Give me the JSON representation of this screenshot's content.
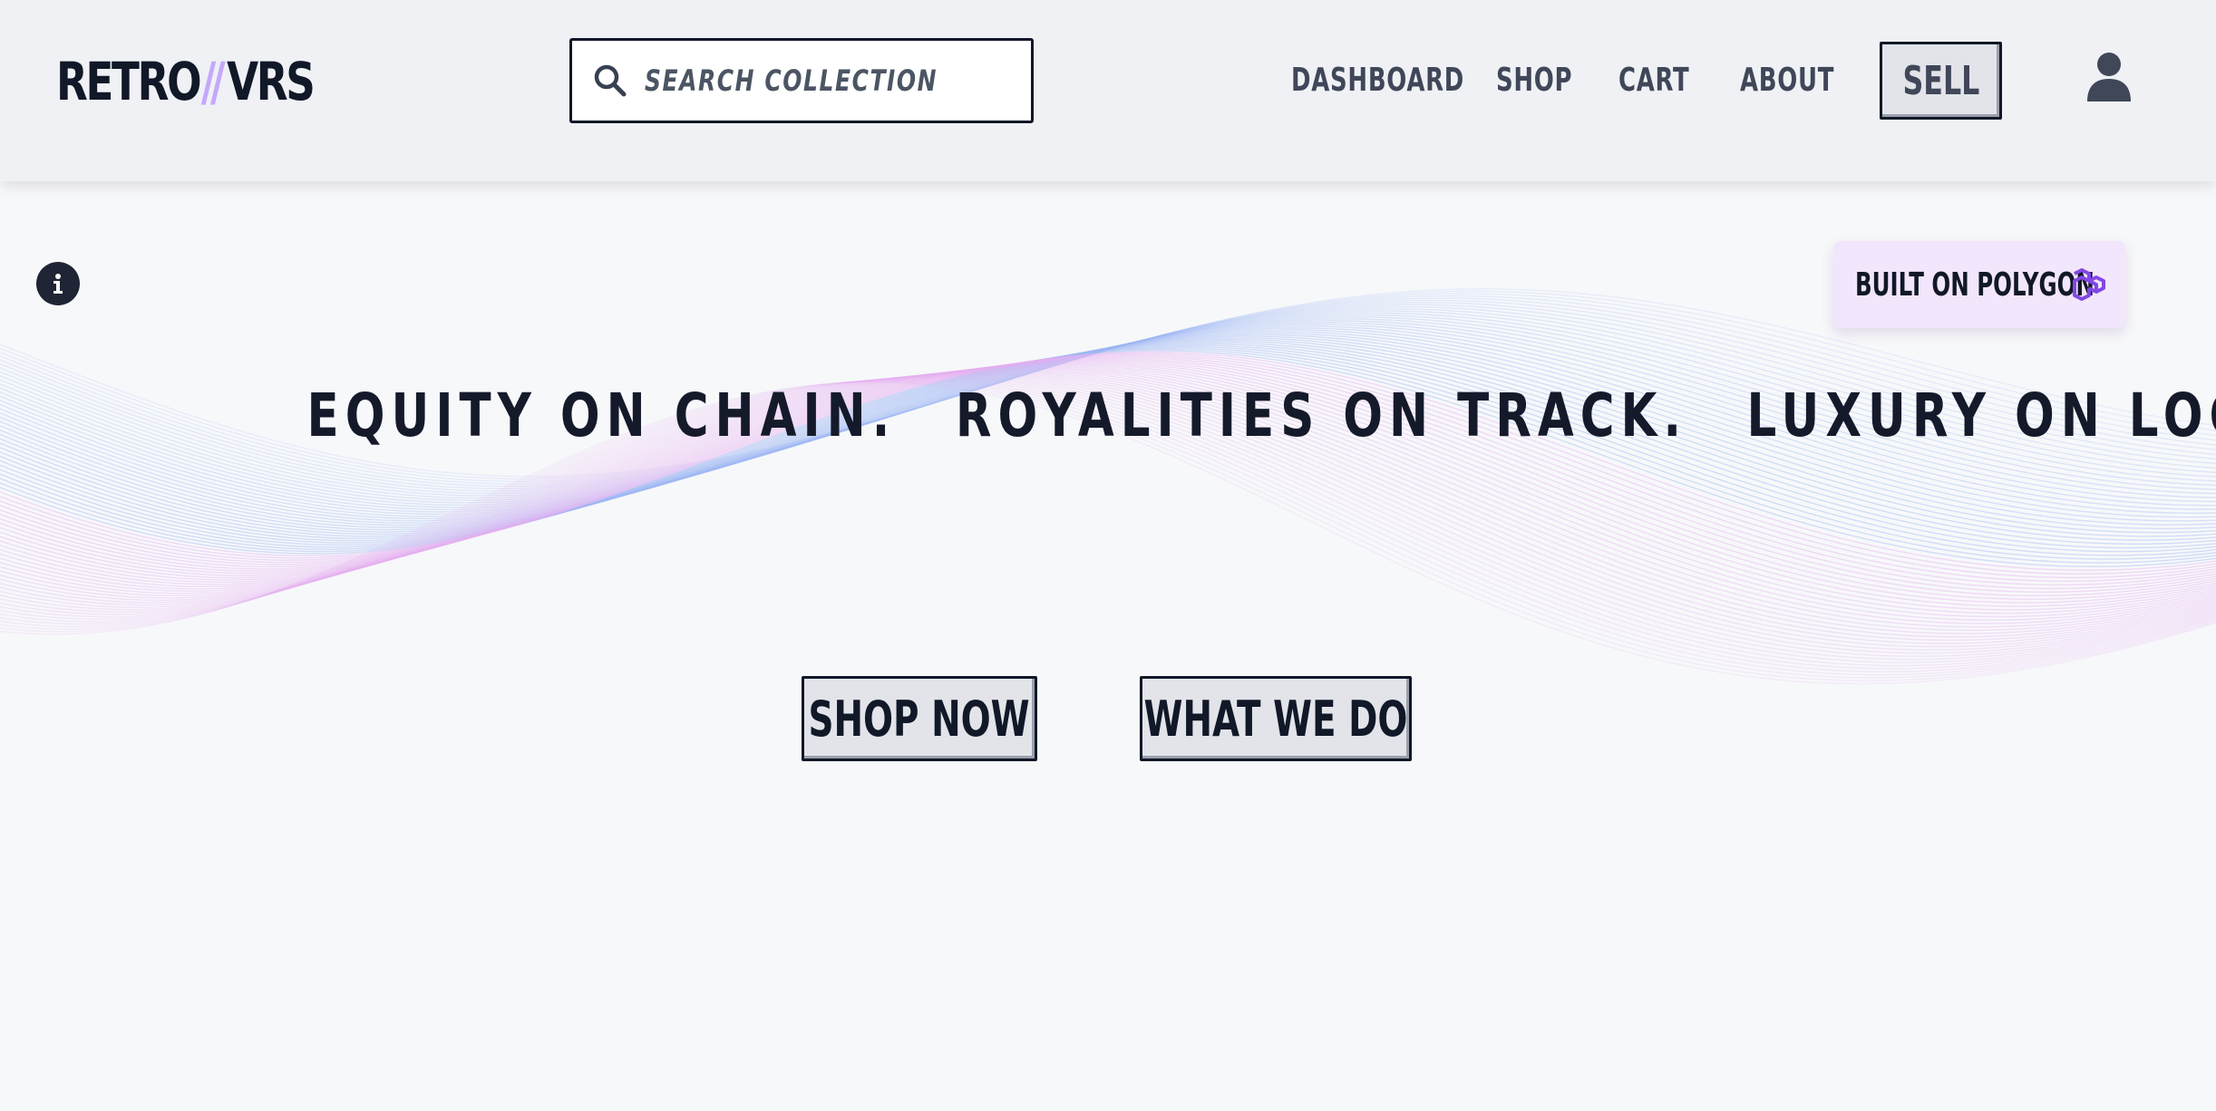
{
  "header": {
    "logo": {
      "left": "RETRO",
      "slashes": "//",
      "right": "VRS"
    },
    "search": {
      "placeholder": "SEARCH COLLECTION",
      "icon": "search-icon"
    },
    "nav": [
      {
        "label": "DASHBOARD"
      },
      {
        "label": "SHOP"
      },
      {
        "label": "CART"
      },
      {
        "label": "ABOUT"
      }
    ],
    "sell_label": "SELL",
    "user_icon": "user-icon"
  },
  "hero": {
    "info_icon": "info-icon",
    "badge": {
      "label": "BUILT ON POLYGON",
      "icon": "polygon-icon"
    },
    "tagline": [
      "EQUITY ON CHAIN.",
      "ROYALITIES ON TRACK.",
      "LUXURY ON LOCK."
    ],
    "buttons": {
      "shop_now": "SHOP NOW",
      "what_we_do": "WHAT WE DO"
    }
  },
  "colors": {
    "header_bg": "#eff1f5",
    "page_bg": "#f7f8fa",
    "text_dark": "#111827",
    "nav_text": "#3f4758",
    "logo_accent": "#c4a8fb",
    "badge_bg": "#f2e6fc",
    "polygon_purple": "#8247e5",
    "wave_blue": "#93b4f5",
    "wave_pink": "#e9a9f0"
  }
}
